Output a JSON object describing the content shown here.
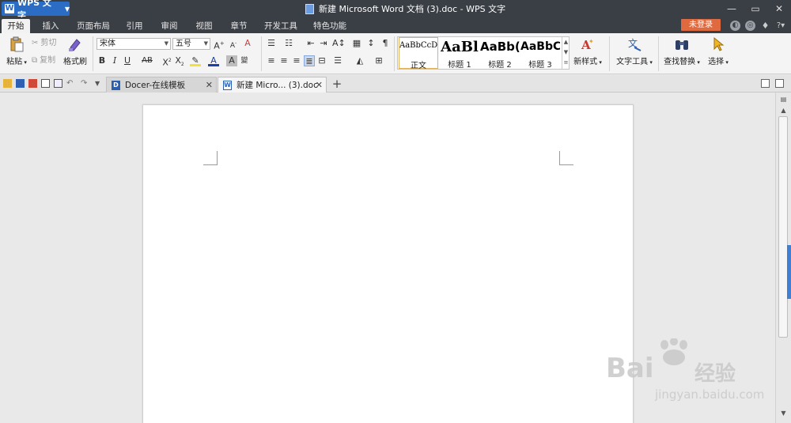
{
  "app": {
    "menu_label": "WPS 文字",
    "logo_letter": "W",
    "window_title": "新建 Microsoft Word 文档 (3).doc - WPS 文字",
    "login_label": "未登录",
    "accent_color": "#2b6cc4",
    "login_color": "#e06a3f"
  },
  "menu": {
    "tabs": [
      "开始",
      "插入",
      "页面布局",
      "引用",
      "审阅",
      "视图",
      "章节",
      "开发工具",
      "特色功能"
    ]
  },
  "ribbon": {
    "paste": "粘贴",
    "cut": "剪切",
    "copy": "复制",
    "format_painter": "格式刷",
    "font_name": "宋体",
    "font_size": "五号",
    "styles": [
      {
        "sample": "AaBbCcDd",
        "name": "正文"
      },
      {
        "sample": "AaBl",
        "name": "标题 1"
      },
      {
        "sample": "AaBb(",
        "name": "标题 2"
      },
      {
        "sample": "AaBbC",
        "name": "标题 3"
      }
    ],
    "new_style": "新样式",
    "text_tools": "文字工具",
    "find_replace": "查找替换",
    "select": "选择"
  },
  "tabsbar": {
    "tabs": [
      {
        "label": "Docer-在线模板"
      },
      {
        "label": "新建 Micro... (3).doc"
      }
    ],
    "new_tab": "+"
  },
  "watermark": {
    "brand": "Bai",
    "brand_cn": "经验",
    "url": "jingyan.baidu.com"
  }
}
